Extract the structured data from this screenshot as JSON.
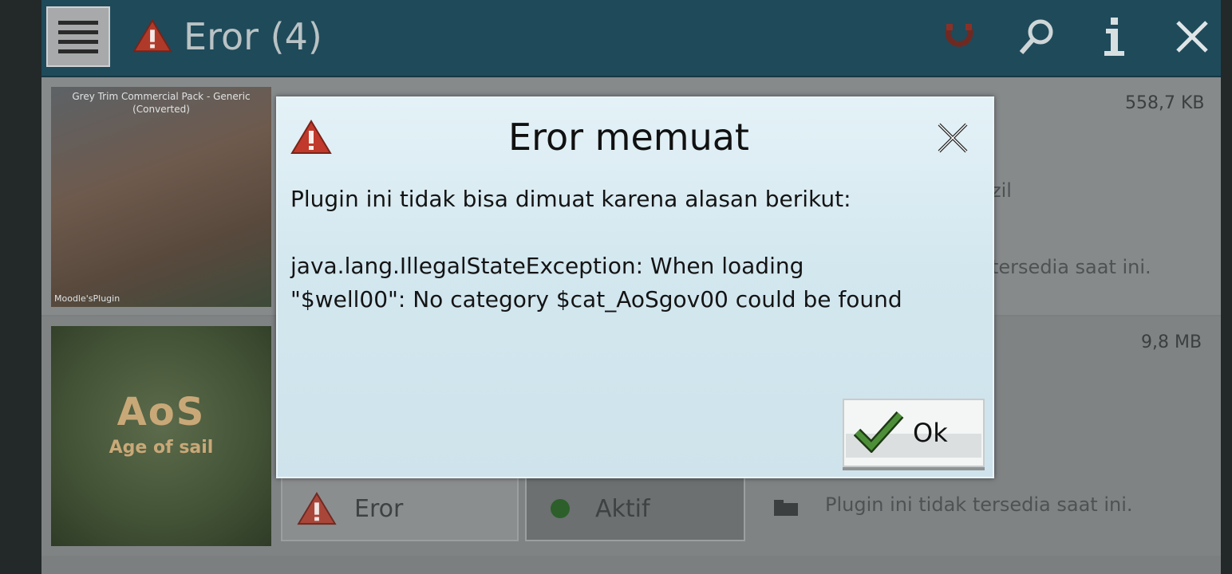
{
  "header": {
    "title": "Eror (4)",
    "icons": [
      "menu-icon",
      "warning-icon",
      "magnet-icon",
      "search-icon",
      "info-icon",
      "close-icon"
    ]
  },
  "list": {
    "items": [
      {
        "thumb_title": "Grey Trim Commercial Pack - Generic (Converted)",
        "thumb_footer": "Moodle'sPlugin",
        "size": "558,7 KB",
        "text_right": "zil",
        "status_text": "tersedia saat ini."
      },
      {
        "thumb_title": "AoS",
        "thumb_subtitle": "Age of sail",
        "size": "9,8 MB",
        "status_buttons": {
          "error": "Eror",
          "active": "Aktif"
        },
        "status_text": "Plugin ini tidak tersedia saat ini."
      }
    ]
  },
  "dialog": {
    "title": "Eror memuat",
    "intro": "Plugin ini tidak bisa dimuat karena alasan berikut:",
    "error_line1": "java.lang.IllegalStateException: When loading",
    "error_line2": "\"$well00\": No category $cat_AoSgov00 could be found",
    "ok_label": "Ok"
  },
  "colors": {
    "topbar": "#1f4a5a",
    "dialog_bg": "#d3e7ef",
    "warning_red": "#c0392b",
    "check_green": "#3f7f2e"
  }
}
